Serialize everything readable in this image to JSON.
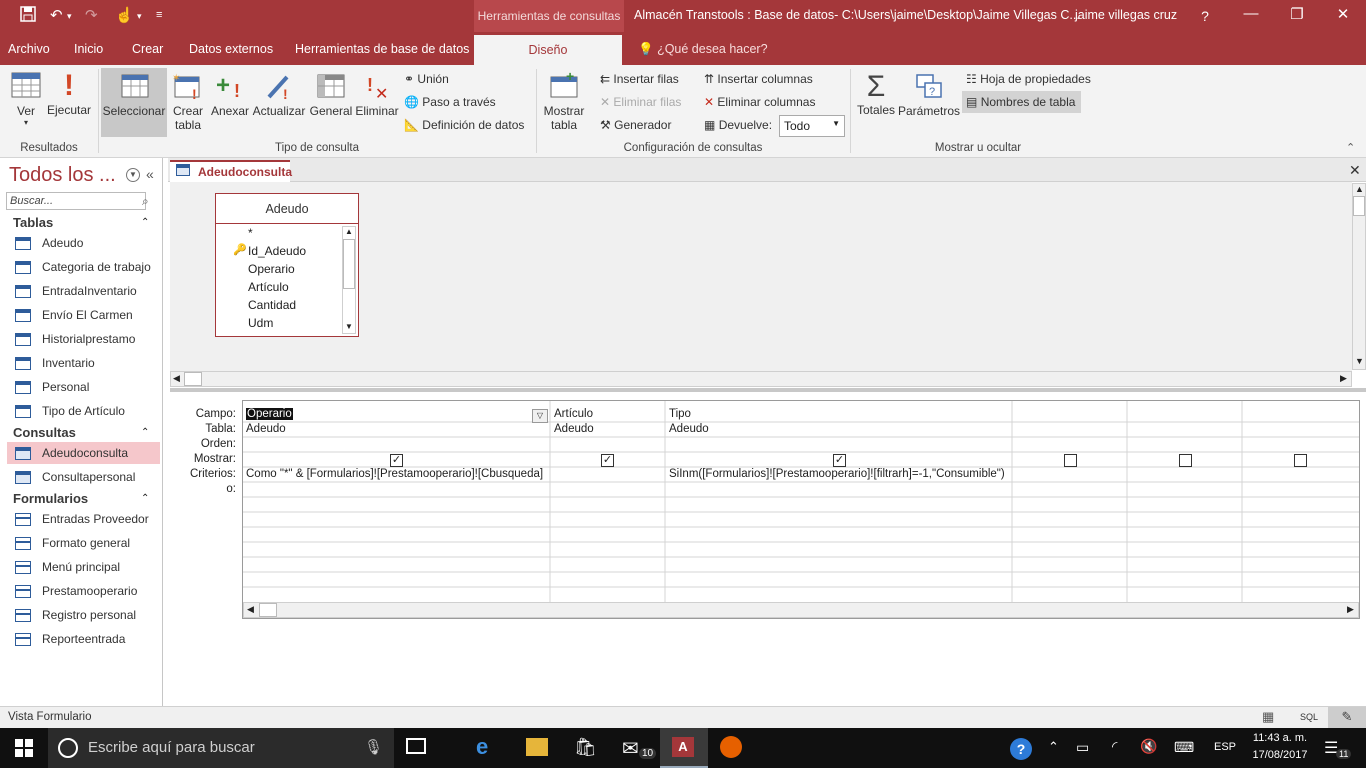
{
  "titlebar": {
    "context_tools": "Herramientas de consultas",
    "title": "Almacén Transtools : Base de datos- C:\\Users\\jaime\\Desktop\\Jaime Villegas C...",
    "user": "jaime villegas cruz",
    "help": "?"
  },
  "tabs": {
    "archivo": "Archivo",
    "inicio": "Inicio",
    "crear": "Crear",
    "datos_externos": "Datos externos",
    "herramientas_bd": "Herramientas de base de datos",
    "diseno": "Diseño",
    "tellme": "¿Qué desea hacer?"
  },
  "ribbon": {
    "ver": "Ver",
    "ejecutar": "Ejecutar",
    "resultados": "Resultados",
    "seleccionar": "Seleccionar",
    "crear1": "Crear",
    "crear2": "tabla",
    "anexar": "Anexar",
    "actualizar": "Actualizar",
    "general": "General",
    "eliminar": "Eliminar",
    "union": "Unión",
    "paso": "Paso a través",
    "definicion": "Definición de datos",
    "tipo_consulta": "Tipo de consulta",
    "mostrar1": "Mostrar",
    "mostrar2": "tabla",
    "insertar_filas": "Insertar filas",
    "eliminar_filas": "Eliminar filas",
    "generador": "Generador",
    "insertar_columnas": "Insertar columnas",
    "eliminar_columnas": "Eliminar columnas",
    "devuelve": "Devuelve:",
    "devuelve_value": "Todo",
    "config": "Configuración de consultas",
    "totales": "Totales",
    "parametros": "Parámetros",
    "hoja_prop": "Hoja de propiedades",
    "nombres_tabla": "Nombres de tabla",
    "mostrar_ocultar": "Mostrar u ocultar"
  },
  "nav": {
    "title": "Todos los ...",
    "search_placeholder": "Buscar...",
    "sec_tablas": "Tablas",
    "sec_consultas": "Consultas",
    "sec_formularios": "Formularios",
    "tablas": [
      "Adeudo",
      "Categoria de trabajo",
      "EntradaInventario",
      "Envío El Carmen",
      "Historialprestamo",
      "Inventario",
      "Personal",
      "Tipo de Artículo"
    ],
    "consultas": [
      "Adeudoconsulta",
      "Consultapersonal"
    ],
    "formularios": [
      "Entradas Proveedor",
      "Formato general",
      "Menú principal",
      "Prestamooperario",
      "Registro personal",
      "Reporteentrada"
    ]
  },
  "doc": {
    "tab": "Adeudoconsulta",
    "table_name": "Adeudo",
    "fields": [
      "*",
      "Id_Adeudo",
      "Operario",
      "Artículo",
      "Cantidad",
      "Udm"
    ]
  },
  "grid": {
    "labels": [
      "Campo:",
      "Tabla:",
      "Orden:",
      "Mostrar:",
      "Criterios:",
      "o:"
    ],
    "col1": {
      "campo": "Operario",
      "tabla": "Adeudo",
      "criterio": "Como \"*\" & [Formularios]![Prestamooperario]![Cbusqueda]"
    },
    "col2": {
      "campo": "Artículo",
      "tabla": "Adeudo"
    },
    "col3": {
      "campo": "Tipo",
      "tabla": "Adeudo",
      "criterio": "SiInm([Formularios]![Prestamooperario]![filtrarh]=-1,\"Consumible\")"
    }
  },
  "status": {
    "text": "Vista Formulario",
    "sql": "SQL"
  },
  "taskbar": {
    "search": "Escribe aquí para buscar",
    "mail_badge": "10",
    "lang": "ESP",
    "time": "11:43 a. m.",
    "date": "17/08/2017",
    "notif": "11"
  }
}
